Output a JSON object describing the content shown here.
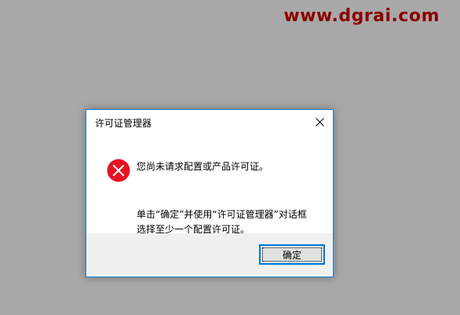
{
  "watermark": {
    "text": "www.dgrai.com",
    "color": "#8b0000"
  },
  "dialog": {
    "title": "许可证管理器",
    "close_icon": "close-icon",
    "message_primary": "您尚未请求配置或产品许可证。",
    "message_line1": "单击“确定”并使用“许可证管理器”对话框",
    "message_line2": "选择至少一个配置许可证。",
    "icon": "error-icon",
    "ok_label": "确定",
    "accent_color": "#0078d7",
    "error_color": "#e81123"
  }
}
